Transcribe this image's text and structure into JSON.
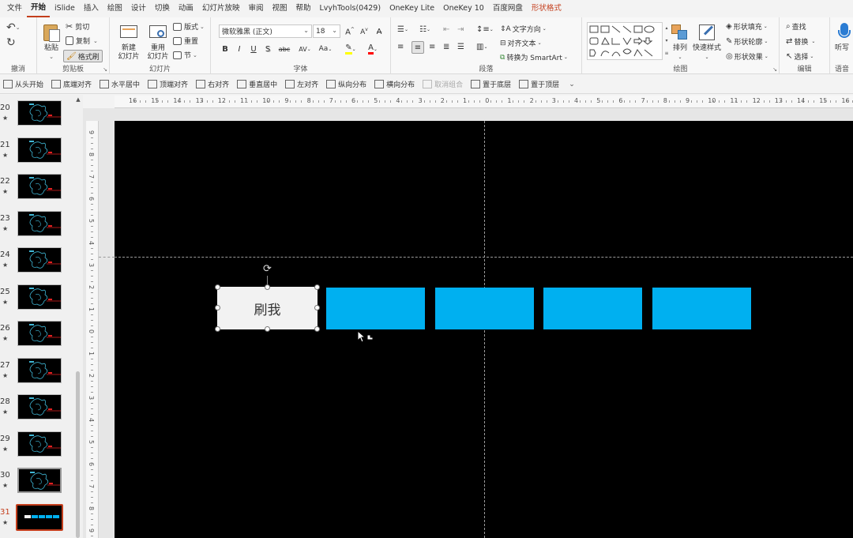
{
  "menu": {
    "tabs": [
      "文件",
      "开始",
      "iSlide",
      "插入",
      "绘图",
      "设计",
      "切换",
      "动画",
      "幻灯片放映",
      "审阅",
      "视图",
      "帮助",
      "LvyhTools(0429)",
      "OneKey Lite",
      "OneKey 10",
      "百度网盘",
      "形状格式"
    ],
    "active": "开始",
    "accent": "形状格式"
  },
  "ribbon": {
    "undo_label": "撤消",
    "clipboard": {
      "label": "剪贴板",
      "paste": "粘贴",
      "cut": "剪切",
      "copy": "复制",
      "format_painter": "格式刷"
    },
    "slides": {
      "label": "幻灯片",
      "new_slide_1": "新建",
      "new_slide_2": "幻灯片",
      "reuse_1": "重用",
      "reuse_2": "幻灯片",
      "layout": "版式",
      "reset": "重置",
      "section": "节"
    },
    "font": {
      "label": "字体",
      "font_name": "微软雅黑 (正文)",
      "font_size": "18",
      "bold": "B",
      "italic": "I",
      "underline": "U",
      "shadow": "S",
      "strike": "abc",
      "spacing": "AV",
      "case": "Aa"
    },
    "paragraph": {
      "label": "段落",
      "text_direction": "文字方向",
      "align_text": "对齐文本",
      "smartart": "转换为 SmartArt"
    },
    "drawing": {
      "label": "绘图",
      "arrange": "排列",
      "quick_styles": "快速样式",
      "fill": "形状填充",
      "outline": "形状轮廓",
      "effects": "形状效果"
    },
    "editing": {
      "label": "编辑",
      "find": "查找",
      "replace": "替换",
      "select": "选择"
    },
    "voice": {
      "label": "语音",
      "dictate": "听写"
    }
  },
  "quickbar": [
    {
      "label": "从头开始",
      "enabled": true
    },
    {
      "label": "底端对齐",
      "enabled": true
    },
    {
      "label": "水平居中",
      "enabled": true
    },
    {
      "label": "顶端对齐",
      "enabled": true
    },
    {
      "label": "右对齐",
      "enabled": true
    },
    {
      "label": "垂直居中",
      "enabled": true
    },
    {
      "label": "左对齐",
      "enabled": true
    },
    {
      "label": "纵向分布",
      "enabled": true
    },
    {
      "label": "横向分布",
      "enabled": true
    },
    {
      "label": "取消组合",
      "enabled": false
    },
    {
      "label": "置于底层",
      "enabled": true
    },
    {
      "label": "置于顶层",
      "enabled": true
    }
  ],
  "thumbnails": [
    {
      "num": "20",
      "star": "★",
      "state": "normal"
    },
    {
      "num": "21",
      "star": "★",
      "state": "normal"
    },
    {
      "num": "22",
      "star": "★",
      "state": "normal"
    },
    {
      "num": "23",
      "star": "★",
      "state": "normal"
    },
    {
      "num": "24",
      "star": "★",
      "state": "normal"
    },
    {
      "num": "25",
      "star": "★",
      "state": "normal"
    },
    {
      "num": "26",
      "star": "★",
      "state": "normal"
    },
    {
      "num": "27",
      "star": "★",
      "state": "normal"
    },
    {
      "num": "28",
      "star": "★",
      "state": "normal"
    },
    {
      "num": "29",
      "star": "★",
      "state": "normal"
    },
    {
      "num": "30",
      "star": "★",
      "state": "hover"
    },
    {
      "num": "31",
      "star": "★",
      "state": "selected"
    }
  ],
  "ruler": {
    "h_ticks": [
      "16",
      "15",
      "14",
      "13",
      "12",
      "11",
      "10",
      "9",
      "8",
      "7",
      "6",
      "5",
      "4",
      "3",
      "2",
      "1",
      "0",
      "1",
      "2",
      "3",
      "4",
      "5",
      "6",
      "7",
      "8",
      "9",
      "10",
      "11",
      "12",
      "13",
      "14",
      "15",
      "16"
    ],
    "v_ticks": [
      "9",
      "8",
      "7",
      "6",
      "5",
      "4",
      "3",
      "2",
      "1",
      "0",
      "1",
      "2",
      "3",
      "4",
      "5",
      "6",
      "7",
      "8",
      "9"
    ]
  },
  "slide": {
    "background": "#000000",
    "selected_shape_text": "刷我",
    "shape_fill_white": "#f2f2f2",
    "shape_fill_blue": "#00b0f0",
    "blue_shape_count": 4
  },
  "colors": {
    "accent": "#c43e1c",
    "blue": "#00b0f0",
    "highlight_yellow": "#ffff00",
    "font_red": "#ff0000"
  }
}
